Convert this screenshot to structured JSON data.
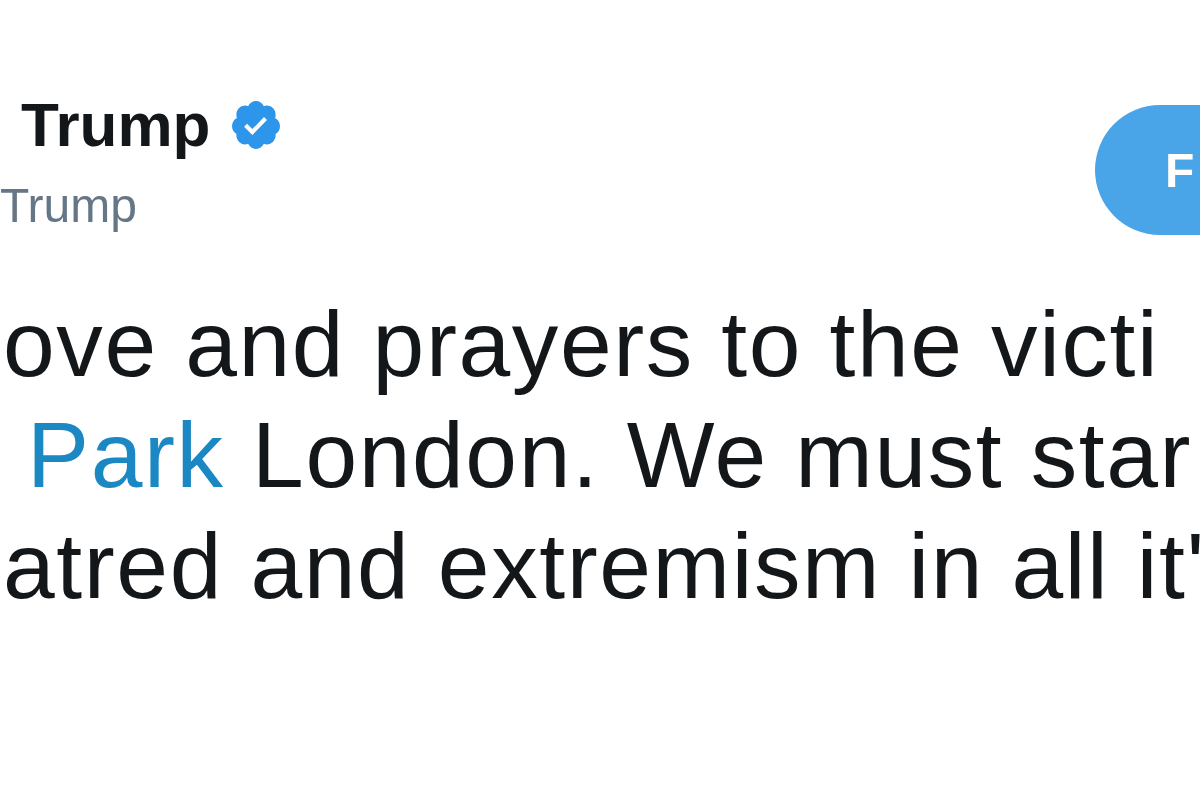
{
  "author": {
    "name": "Trump",
    "verified": true,
    "handle": "Trump"
  },
  "follow_button": {
    "label": "F"
  },
  "tweet": {
    "lines": [
      [
        {
          "kind": "text",
          "text": "ove and prayers to the victi"
        }
      ],
      [
        {
          "kind": "hashtag",
          "text": "Park"
        },
        {
          "kind": "text",
          "text": " London. We must star"
        }
      ],
      [
        {
          "kind": "text",
          "text": "atred and extremism in all it'"
        }
      ]
    ]
  }
}
